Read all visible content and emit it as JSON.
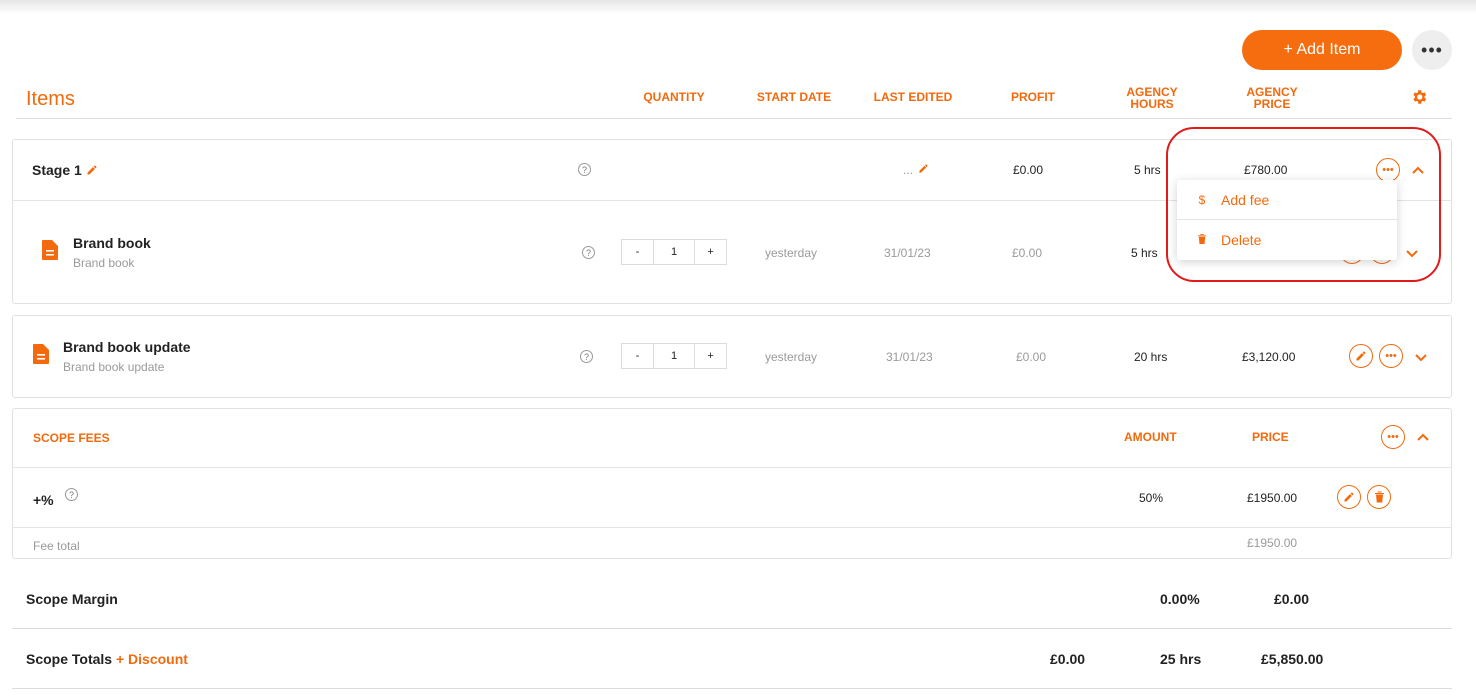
{
  "toolbar": {
    "add_item_label": "+ Add Item",
    "more_label": "•••"
  },
  "header": {
    "title": "Items",
    "columns": {
      "quantity": "QUANTITY",
      "start_date": "START DATE",
      "last_edited": "LAST EDITED",
      "profit": "PROFIT",
      "agency_hours_1": "AGENCY",
      "agency_hours_2": "HOURS",
      "agency_price_1": "AGENCY",
      "agency_price_2": "PRICE"
    }
  },
  "stage": {
    "title": "Stage 1",
    "last_edited": "...",
    "profit": "£0.00",
    "hours": "5 hrs",
    "price": "£780.00",
    "item": {
      "name": "Brand book",
      "sub": "Brand book",
      "qty": "1",
      "minus": "-",
      "plus": "+",
      "start": "yesterday",
      "edited": "31/01/23",
      "profit": "£0.00",
      "hours": "5 hrs"
    }
  },
  "item2": {
    "name": "Brand book update",
    "sub": "Brand book update",
    "qty": "1",
    "minus": "-",
    "plus": "+",
    "start": "yesterday",
    "edited": "31/01/23",
    "profit": "£0.00",
    "hours": "20 hrs",
    "price": "£3,120.00"
  },
  "popup": {
    "add_fee": "Add fee",
    "delete": "Delete",
    "add_fee_icon": "$"
  },
  "scope_fees": {
    "title": "SCOPE FEES",
    "amount_header": "AMOUNT",
    "price_header": "PRICE",
    "row_label": "+%",
    "row_amount": "50%",
    "row_price": "£1950.00",
    "total_label": "Fee total",
    "total_price": "£1950.00"
  },
  "scope_margin": {
    "label": "Scope Margin",
    "pct": "0.00%",
    "value": "£0.00"
  },
  "scope_totals": {
    "label": "Scope Totals",
    "discount": "+ Discount",
    "profit": "£0.00",
    "hours": "25 hrs",
    "price": "£5,850.00"
  }
}
